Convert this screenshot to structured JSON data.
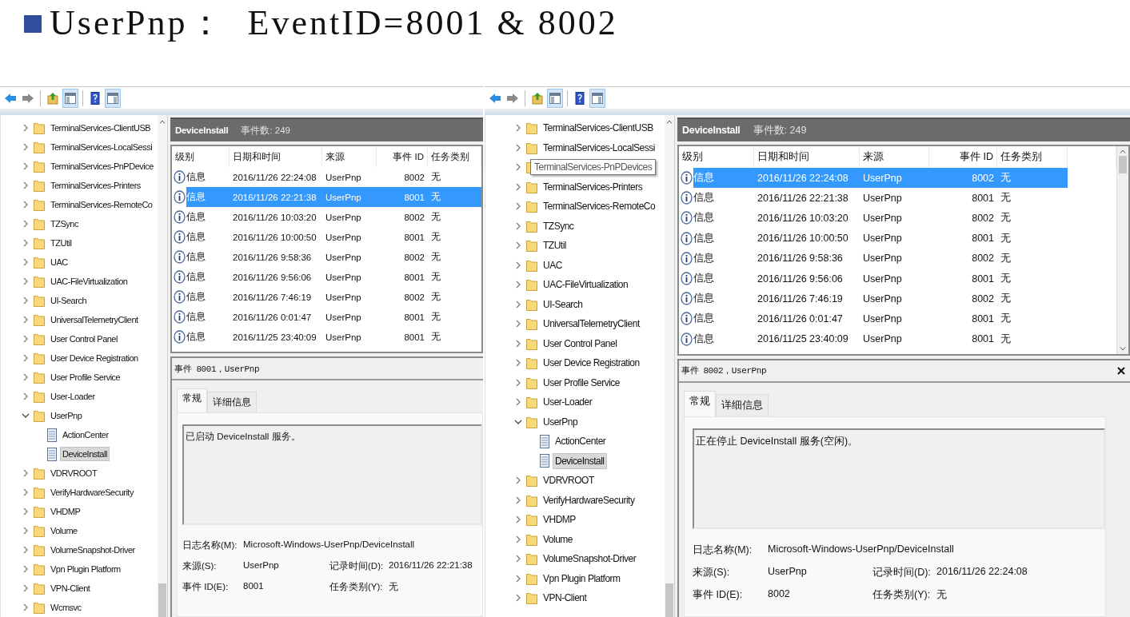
{
  "slide": {
    "title": "UserPnp：  EventID=8001 & 8002"
  },
  "windows": [
    {
      "toolbar": [
        {
          "kind": "back",
          "selected": false
        },
        {
          "kind": "forward",
          "selected": false
        },
        {
          "kind": "up",
          "selected": false
        },
        {
          "kind": "tree-toggle",
          "selected": true
        },
        {
          "kind": "help",
          "selected": false
        },
        {
          "kind": "pane-toggle",
          "selected": true
        }
      ],
      "tree": [
        {
          "kind": "folder",
          "label": "TerminalServices-ClientUSB",
          "expanded": false,
          "selected": false
        },
        {
          "kind": "folder",
          "label": "TerminalServices-LocalSessi",
          "expanded": false,
          "selected": false
        },
        {
          "kind": "folder",
          "label": "TerminalServices-PnPDevice",
          "expanded": false,
          "selected": false
        },
        {
          "kind": "folder",
          "label": "TerminalServices-Printers",
          "expanded": false,
          "selected": false
        },
        {
          "kind": "folder",
          "label": "TerminalServices-RemoteCo",
          "expanded": false,
          "selected": false
        },
        {
          "kind": "folder",
          "label": "TZSync",
          "expanded": false,
          "selected": false
        },
        {
          "kind": "folder",
          "label": "TZUtil",
          "expanded": false,
          "selected": false
        },
        {
          "kind": "folder",
          "label": "UAC",
          "expanded": false,
          "selected": false
        },
        {
          "kind": "folder",
          "label": "UAC-FileVirtualization",
          "expanded": false,
          "selected": false
        },
        {
          "kind": "folder",
          "label": "UI-Search",
          "expanded": false,
          "selected": false
        },
        {
          "kind": "folder",
          "label": "UniversalTelemetryClient",
          "expanded": false,
          "selected": false
        },
        {
          "kind": "folder",
          "label": "User Control Panel",
          "expanded": false,
          "selected": false
        },
        {
          "kind": "folder",
          "label": "User Device Registration",
          "expanded": false,
          "selected": false
        },
        {
          "kind": "folder",
          "label": "User Profile Service",
          "expanded": false,
          "selected": false
        },
        {
          "kind": "folder",
          "label": "User-Loader",
          "expanded": false,
          "selected": false
        },
        {
          "kind": "folder",
          "label": "UserPnp",
          "expanded": true,
          "selected": false,
          "children": [
            {
              "kind": "log",
              "label": "ActionCenter",
              "selected": false
            },
            {
              "kind": "log",
              "label": "DeviceInstall",
              "selected": true
            }
          ]
        },
        {
          "kind": "folder",
          "label": "VDRVROOT",
          "expanded": false,
          "selected": false
        },
        {
          "kind": "folder",
          "label": "VerifyHardwareSecurity",
          "expanded": false,
          "selected": false
        },
        {
          "kind": "folder",
          "label": "VHDMP",
          "expanded": false,
          "selected": false
        },
        {
          "kind": "folder",
          "label": "Volume",
          "expanded": false,
          "selected": false
        },
        {
          "kind": "folder",
          "label": "VolumeSnapshot-Driver",
          "expanded": false,
          "selected": false
        },
        {
          "kind": "folder",
          "label": "Vpn Plugin Platform",
          "expanded": false,
          "selected": false
        },
        {
          "kind": "folder",
          "label": "VPN-Client",
          "expanded": false,
          "selected": false
        },
        {
          "kind": "folder",
          "label": "Wcmsvc",
          "expanded": false,
          "selected": false
        }
      ],
      "log": {
        "name": "DeviceInstall",
        "count": "事件数: 249"
      },
      "columns": [
        "级别",
        "日期和时间",
        "来源",
        "事件 ID",
        "任务类别"
      ],
      "table_scrollbar": false,
      "rows": [
        {
          "level": "信息",
          "date": "2016/11/26 22:24:08",
          "source": "UserPnp",
          "event_id": "8002",
          "task": "无",
          "selected": false
        },
        {
          "level": "信息",
          "date": "2016/11/26 22:21:38",
          "source": "UserPnp",
          "event_id": "8001",
          "task": "无",
          "selected": true
        },
        {
          "level": "信息",
          "date": "2016/11/26 10:03:20",
          "source": "UserPnp",
          "event_id": "8002",
          "task": "无",
          "selected": false
        },
        {
          "level": "信息",
          "date": "2016/11/26 10:00:50",
          "source": "UserPnp",
          "event_id": "8001",
          "task": "无",
          "selected": false
        },
        {
          "level": "信息",
          "date": "2016/11/26 9:58:36",
          "source": "UserPnp",
          "event_id": "8002",
          "task": "无",
          "selected": false
        },
        {
          "level": "信息",
          "date": "2016/11/26 9:56:06",
          "source": "UserPnp",
          "event_id": "8001",
          "task": "无",
          "selected": false
        },
        {
          "level": "信息",
          "date": "2016/11/26 7:46:19",
          "source": "UserPnp",
          "event_id": "8002",
          "task": "无",
          "selected": false
        },
        {
          "level": "信息",
          "date": "2016/11/26 0:01:47",
          "source": "UserPnp",
          "event_id": "8001",
          "task": "无",
          "selected": false
        },
        {
          "level": "信息",
          "date": "2016/11/25 23:40:09",
          "source": "UserPnp",
          "event_id": "8001",
          "task": "无",
          "selected": false
        }
      ],
      "detail": {
        "title": "事件 8001，UserPnp",
        "closable": false,
        "tabs": [
          {
            "label": "常规",
            "selected": true
          },
          {
            "label": "详细信息",
            "selected": false
          }
        ],
        "description": "已启动 DeviceInstall 服务。",
        "log_name": {
          "label": "日志名称(M):",
          "value": "Microsoft-Windows-UserPnp/DeviceInstall"
        },
        "fields": [
          {
            "label": "来源(S):",
            "value": "UserPnp"
          },
          {
            "label": "记录时间(D):",
            "value": "2016/11/26 22:21:38"
          },
          {
            "label": "事件 ID(E):",
            "value": "8001"
          },
          {
            "label": "任务类别(Y):",
            "value": "无"
          }
        ]
      }
    },
    {
      "toolbar": [
        {
          "kind": "back",
          "selected": false
        },
        {
          "kind": "forward",
          "selected": false
        },
        {
          "kind": "up",
          "selected": false
        },
        {
          "kind": "tree-toggle",
          "selected": true
        },
        {
          "kind": "help",
          "selected": false
        },
        {
          "kind": "pane-toggle",
          "selected": true
        }
      ],
      "tree": [
        {
          "kind": "folder",
          "label": "TerminalServices-ClientUSB",
          "expanded": false,
          "selected": false
        },
        {
          "kind": "folder",
          "label": "TerminalServices-LocalSessi",
          "expanded": false,
          "selected": false
        },
        {
          "kind": "folder",
          "tooltip": "TerminalServices-PnPDevices",
          "expanded": false,
          "selected": false
        },
        {
          "kind": "folder",
          "label": "TerminalServices-Printers",
          "expanded": false,
          "selected": false
        },
        {
          "kind": "folder",
          "label": "TerminalServices-RemoteCo",
          "expanded": false,
          "selected": false
        },
        {
          "kind": "folder",
          "label": "TZSync",
          "expanded": false,
          "selected": false
        },
        {
          "kind": "folder",
          "label": "TZUtil",
          "expanded": false,
          "selected": false
        },
        {
          "kind": "folder",
          "label": "UAC",
          "expanded": false,
          "selected": false
        },
        {
          "kind": "folder",
          "label": "UAC-FileVirtualization",
          "expanded": false,
          "selected": false
        },
        {
          "kind": "folder",
          "label": "UI-Search",
          "expanded": false,
          "selected": false
        },
        {
          "kind": "folder",
          "label": "UniversalTelemetryClient",
          "expanded": false,
          "selected": false
        },
        {
          "kind": "folder",
          "label": "User Control Panel",
          "expanded": false,
          "selected": false
        },
        {
          "kind": "folder",
          "label": "User Device Registration",
          "expanded": false,
          "selected": false
        },
        {
          "kind": "folder",
          "label": "User Profile Service",
          "expanded": false,
          "selected": false
        },
        {
          "kind": "folder",
          "label": "User-Loader",
          "expanded": false,
          "selected": false
        },
        {
          "kind": "folder",
          "label": "UserPnp",
          "expanded": true,
          "selected": false,
          "children": [
            {
              "kind": "log",
              "label": "ActionCenter",
              "selected": false
            },
            {
              "kind": "log",
              "label": "DeviceInstall",
              "selected": true
            }
          ]
        },
        {
          "kind": "folder",
          "label": "VDRVROOT",
          "expanded": false,
          "selected": false
        },
        {
          "kind": "folder",
          "label": "VerifyHardwareSecurity",
          "expanded": false,
          "selected": false
        },
        {
          "kind": "folder",
          "label": "VHDMP",
          "expanded": false,
          "selected": false
        },
        {
          "kind": "folder",
          "label": "Volume",
          "expanded": false,
          "selected": false
        },
        {
          "kind": "folder",
          "label": "VolumeSnapshot-Driver",
          "expanded": false,
          "selected": false
        },
        {
          "kind": "folder",
          "label": "Vpn Plugin Platform",
          "expanded": false,
          "selected": false
        },
        {
          "kind": "folder",
          "label": "VPN-Client",
          "expanded": false,
          "selected": false
        }
      ],
      "log": {
        "name": "DeviceInstall",
        "count": "事件数: 249"
      },
      "columns": [
        "级别",
        "日期和时间",
        "来源",
        "事件 ID",
        "任务类别"
      ],
      "table_scrollbar": true,
      "rows": [
        {
          "level": "信息",
          "date": "2016/11/26 22:24:08",
          "source": "UserPnp",
          "event_id": "8002",
          "task": "无",
          "selected": true
        },
        {
          "level": "信息",
          "date": "2016/11/26 22:21:38",
          "source": "UserPnp",
          "event_id": "8001",
          "task": "无",
          "selected": false
        },
        {
          "level": "信息",
          "date": "2016/11/26 10:03:20",
          "source": "UserPnp",
          "event_id": "8002",
          "task": "无",
          "selected": false
        },
        {
          "level": "信息",
          "date": "2016/11/26 10:00:50",
          "source": "UserPnp",
          "event_id": "8001",
          "task": "无",
          "selected": false
        },
        {
          "level": "信息",
          "date": "2016/11/26 9:58:36",
          "source": "UserPnp",
          "event_id": "8002",
          "task": "无",
          "selected": false
        },
        {
          "level": "信息",
          "date": "2016/11/26 9:56:06",
          "source": "UserPnp",
          "event_id": "8001",
          "task": "无",
          "selected": false
        },
        {
          "level": "信息",
          "date": "2016/11/26 7:46:19",
          "source": "UserPnp",
          "event_id": "8002",
          "task": "无",
          "selected": false
        },
        {
          "level": "信息",
          "date": "2016/11/26 0:01:47",
          "source": "UserPnp",
          "event_id": "8001",
          "task": "无",
          "selected": false
        },
        {
          "level": "信息",
          "date": "2016/11/25 23:40:09",
          "source": "UserPnp",
          "event_id": "8001",
          "task": "无",
          "selected": false
        }
      ],
      "detail": {
        "title": "事件 8002，UserPnp",
        "closable": true,
        "tabs": [
          {
            "label": "常规",
            "selected": true
          },
          {
            "label": "详细信息",
            "selected": false
          }
        ],
        "description": "正在停止 DeviceInstall 服务(空闲)。",
        "log_name": {
          "label": "日志名称(M):",
          "value": "Microsoft-Windows-UserPnp/DeviceInstall"
        },
        "fields": [
          {
            "label": "来源(S):",
            "value": "UserPnp"
          },
          {
            "label": "记录时间(D):",
            "value": "2016/11/26 22:24:08"
          },
          {
            "label": "事件 ID(E):",
            "value": "8002"
          },
          {
            "label": "任务类别(Y):",
            "value": "无"
          }
        ]
      }
    }
  ]
}
